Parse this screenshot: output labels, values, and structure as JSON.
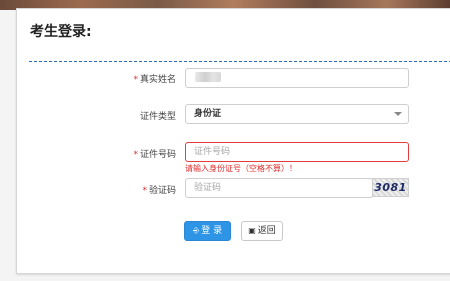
{
  "page_title": "考生登录:",
  "form": {
    "name": {
      "label": "真实姓名",
      "required_mark": "*"
    },
    "id_type": {
      "label": "证件类型",
      "selected": "身份证"
    },
    "id_number": {
      "label": "证件号码",
      "required_mark": "*",
      "placeholder": "证件号码",
      "error": "请输入身份证号（空格不算）！"
    },
    "captcha": {
      "label": "验证码",
      "required_mark": "*",
      "placeholder": "验证码",
      "image_text": "3081"
    }
  },
  "buttons": {
    "login": {
      "label": "登 录",
      "icon": "login-icon"
    },
    "back": {
      "label": "返回",
      "icon": "binoculars-icon"
    }
  },
  "colors": {
    "accent": "#2e95e6",
    "error": "#e12b2b",
    "divider": "#2a6fb6"
  }
}
